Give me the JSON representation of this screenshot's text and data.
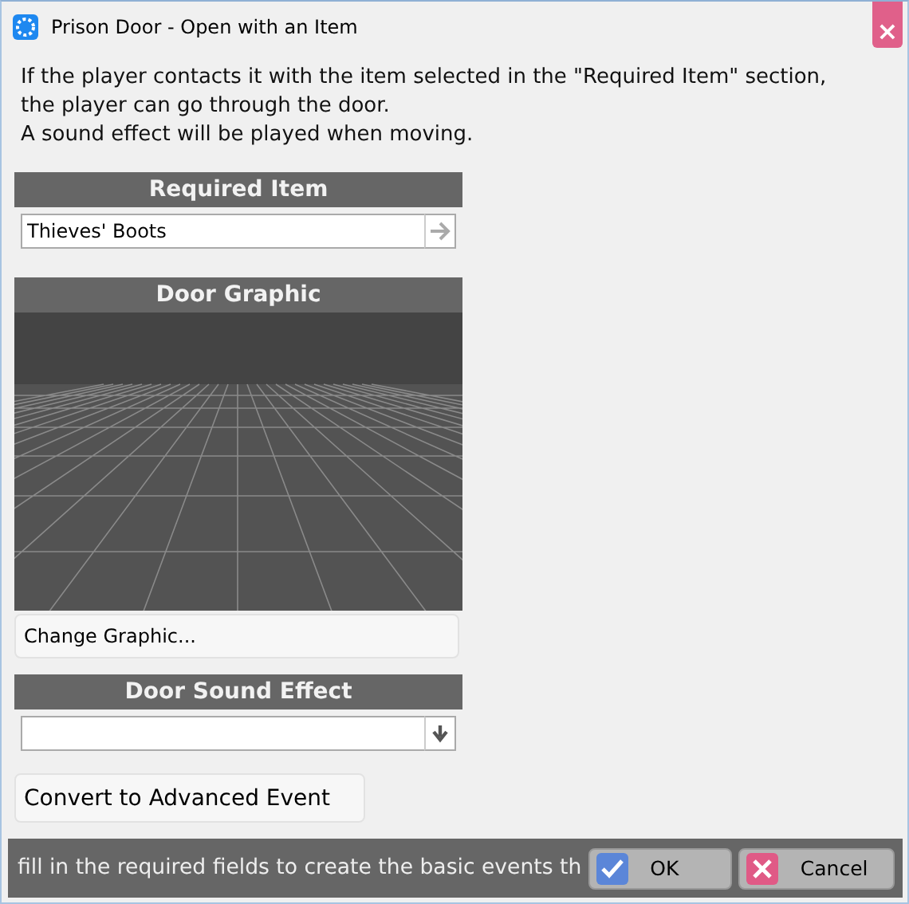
{
  "window": {
    "title": "Prison Door - Open with an Item",
    "close": "×"
  },
  "description": [
    "If the player contacts it with the item selected in the \"Required Item\" section, the player can go through the door.",
    "A sound effect will be played when moving."
  ],
  "required_item": {
    "heading": "Required Item",
    "value": "Thieves' Boots"
  },
  "door_graphic": {
    "heading": "Door Graphic",
    "button": "Change Graphic..."
  },
  "door_sound_effect": {
    "heading": "Door Sound Effect"
  },
  "convert_button": "Convert to Advanced Event",
  "footer": {
    "message": "fill in the required fields to create the basic events th",
    "buttons": [
      {
        "kind": "ok",
        "label": "OK"
      },
      {
        "kind": "cancel",
        "label": "Cancel"
      }
    ]
  }
}
